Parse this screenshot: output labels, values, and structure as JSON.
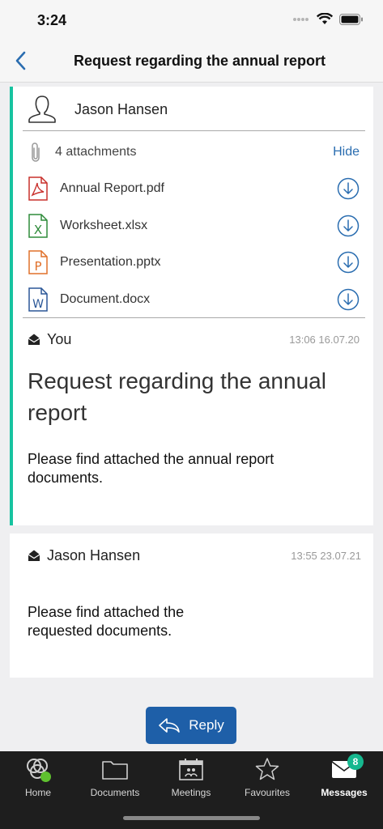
{
  "status": {
    "time": "3:24"
  },
  "nav": {
    "title": "Request regarding the annual report"
  },
  "thread": {
    "sender": "Jason Hansen",
    "attachments": {
      "count_label": "4 attachments",
      "toggle_label": "Hide",
      "files": [
        {
          "name": "Annual Report.pdf",
          "type": "pdf"
        },
        {
          "name": "Worksheet.xlsx",
          "type": "xlsx"
        },
        {
          "name": "Presentation.pptx",
          "type": "pptx"
        },
        {
          "name": "Document.docx",
          "type": "docx"
        }
      ]
    },
    "messages": [
      {
        "sender": "You",
        "time": "13:06 16.07.20",
        "subject": "Request regarding the annual report",
        "body": "Please find attached the annual report documents."
      },
      {
        "sender": "Jason Hansen",
        "time": "13:55 23.07.21",
        "body": "Please find attached the requested documents."
      }
    ]
  },
  "reply_label": "Reply",
  "tabs": [
    {
      "label": "Home",
      "icon": "home-logo-icon"
    },
    {
      "label": "Documents",
      "icon": "folder-icon"
    },
    {
      "label": "Meetings",
      "icon": "calendar-icon"
    },
    {
      "label": "Favourites",
      "icon": "star-icon"
    },
    {
      "label": "Messages",
      "icon": "envelope-icon",
      "badge": "8",
      "active": true
    }
  ],
  "colors": {
    "accent": "#17c3a0",
    "link": "#2a6db0",
    "reply": "#1e5fa8",
    "tabbar": "#1e1e1e",
    "badge": "#16b88f"
  }
}
